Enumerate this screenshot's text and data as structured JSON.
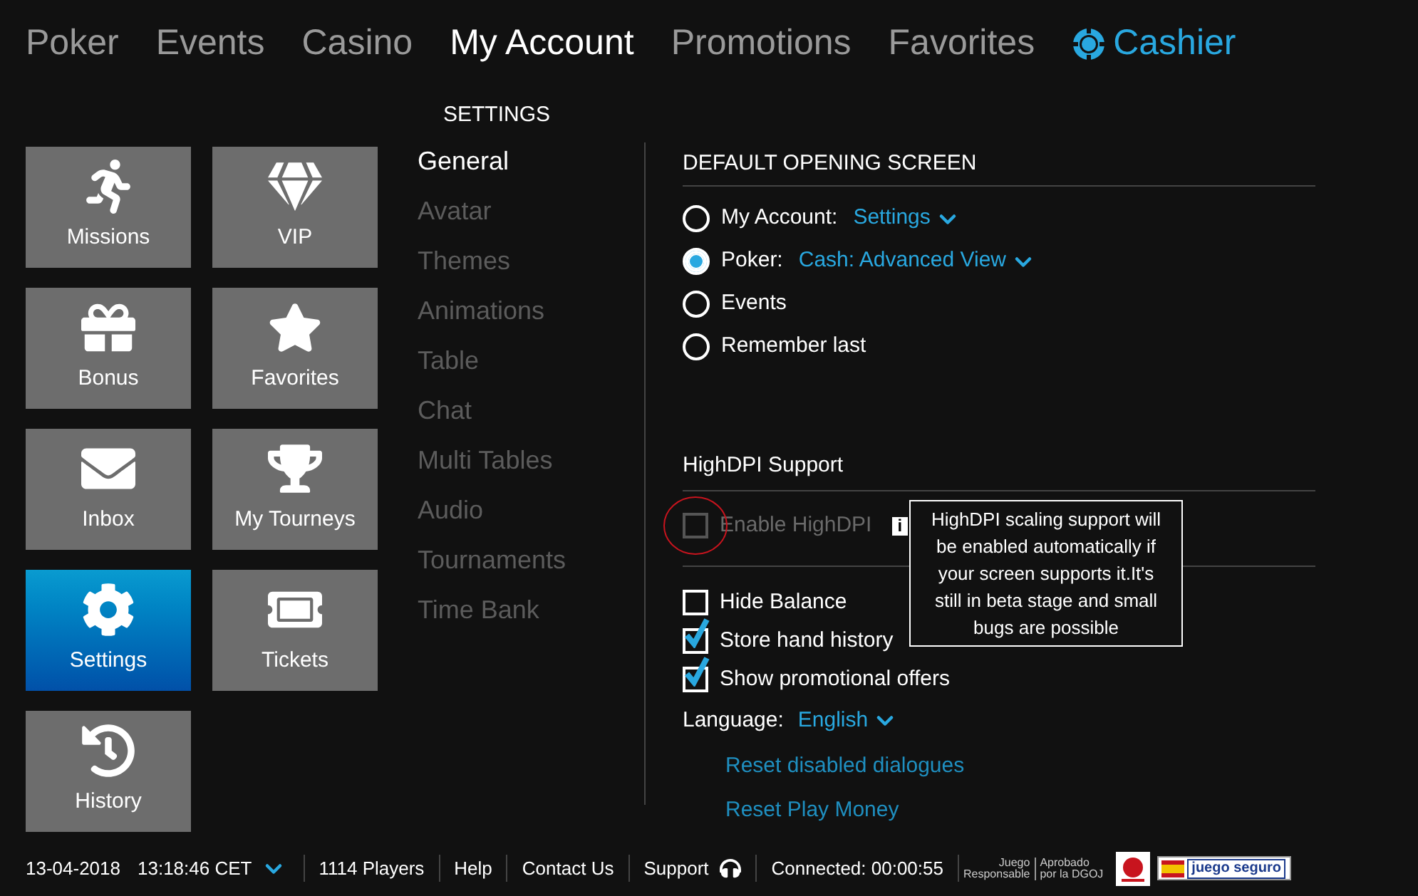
{
  "nav": [
    {
      "label": "Poker",
      "selected": false,
      "kind": "text"
    },
    {
      "label": "Events",
      "selected": false,
      "kind": "text"
    },
    {
      "label": "Casino",
      "selected": false,
      "kind": "text"
    },
    {
      "label": "My Account",
      "selected": true,
      "kind": "text"
    },
    {
      "label": "Promotions",
      "selected": false,
      "kind": "text"
    },
    {
      "label": "Favorites",
      "selected": false,
      "kind": "text"
    },
    {
      "label": "Cashier",
      "selected": false,
      "kind": "cashier"
    }
  ],
  "section_title": "SETTINGS",
  "tiles": [
    {
      "label": "Missions",
      "selected": false,
      "kind": "missions"
    },
    {
      "label": "VIP",
      "selected": false,
      "kind": "vip"
    },
    {
      "label": "Bonus",
      "selected": false,
      "kind": "bonus"
    },
    {
      "label": "Favorites",
      "selected": false,
      "kind": "favorites"
    },
    {
      "label": "Inbox",
      "selected": false,
      "kind": "inbox"
    },
    {
      "label": "My Tourneys",
      "selected": false,
      "kind": "tourneys"
    },
    {
      "label": "Settings",
      "selected": true,
      "kind": "settings"
    },
    {
      "label": "Tickets",
      "selected": false,
      "kind": "tickets"
    },
    {
      "label": "History",
      "selected": false,
      "kind": "history"
    }
  ],
  "settings_menu": [
    {
      "label": "General",
      "selected": true
    },
    {
      "label": "Avatar",
      "selected": false
    },
    {
      "label": "Themes",
      "selected": false
    },
    {
      "label": "Animations",
      "selected": false
    },
    {
      "label": "Table",
      "selected": false
    },
    {
      "label": "Chat",
      "selected": false
    },
    {
      "label": "Multi Tables",
      "selected": false
    },
    {
      "label": "Audio",
      "selected": false
    },
    {
      "label": "Tournaments",
      "selected": false
    },
    {
      "label": "Time Bank",
      "selected": false
    }
  ],
  "default_opening_screen": {
    "heading": "DEFAULT OPENING SCREEN",
    "options": [
      {
        "label": "My Account:",
        "selected": false,
        "value": "Settings"
      },
      {
        "label": "Poker:",
        "selected": true,
        "value": "Cash: Advanced View"
      },
      {
        "label": "Events",
        "selected": false
      },
      {
        "label": "Remember last",
        "selected": false
      }
    ]
  },
  "highdpi": {
    "heading": "HighDPI Support",
    "label": "Enable HighDPI",
    "checked": false,
    "disabled": true,
    "info": "i",
    "tooltip": "HighDPI scaling support will be enabled automatically if your screen supports it.It's still in beta stage and small bugs are possible"
  },
  "options": [
    {
      "label": "Hide Balance",
      "checked": false
    },
    {
      "label": "Store hand history",
      "checked": true
    },
    {
      "label": "Show promotional offers",
      "checked": true
    }
  ],
  "language": {
    "label": "Language:",
    "value": "English"
  },
  "links": [
    "Reset disabled dialogues",
    "Reset Play Money"
  ],
  "status_bar": {
    "date": "13-04-2018",
    "time": "13:18:46 CET",
    "players": "1114 Players",
    "help": "Help",
    "contact": "Contact Us",
    "support": "Support",
    "connected": "Connected: 00:00:55",
    "juego_responsable": [
      "Juego",
      "Responsable"
    ],
    "aprobado": [
      "Aprobado",
      "por la DGOJ"
    ],
    "juego_seguro": "juego seguro"
  }
}
